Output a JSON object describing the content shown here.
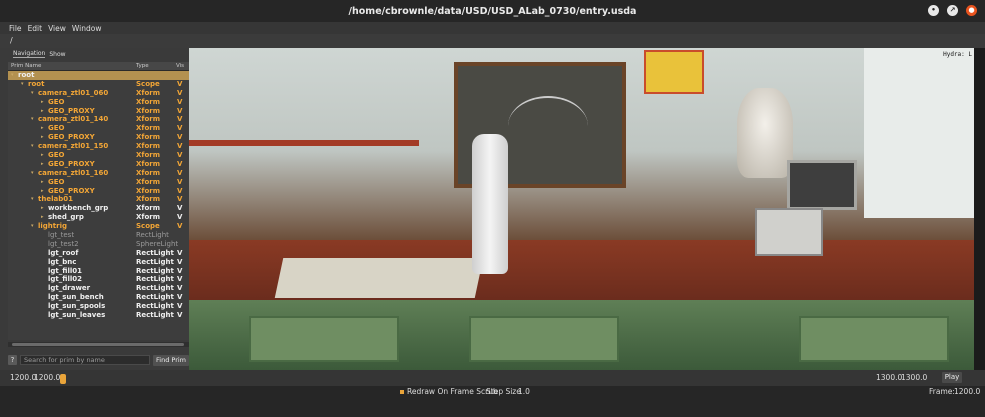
{
  "window": {
    "title": "/home/cbrownle/data/USD/USD_ALab_0730/entry.usda",
    "controls": {
      "minimize": "•",
      "maximize": "↗",
      "close": "●"
    }
  },
  "menu": [
    "File",
    "Edit",
    "View",
    "Window"
  ],
  "path": "/",
  "left_panel": {
    "tabs": [
      "Navigation",
      "Show"
    ],
    "columns": {
      "name": "Prim Name",
      "type": "Type",
      "vis": "Vis"
    },
    "rows": [
      {
        "name": "root",
        "type": "",
        "vis": "",
        "depth": 0,
        "arrow": "▾",
        "color": "white",
        "selected": true
      },
      {
        "name": "root",
        "type": "Scope",
        "vis": "V",
        "depth": 1,
        "arrow": "▾",
        "color": "orange"
      },
      {
        "name": "camera_ztl01_060",
        "type": "Xform",
        "vis": "V",
        "depth": 2,
        "arrow": "▾",
        "color": "orange"
      },
      {
        "name": "GEO",
        "type": "Xform",
        "vis": "V",
        "depth": 3,
        "arrow": "▸",
        "color": "orange"
      },
      {
        "name": "GEO_PROXY",
        "type": "Xform",
        "vis": "V",
        "depth": 3,
        "arrow": "▸",
        "color": "orange"
      },
      {
        "name": "camera_ztl01_140",
        "type": "Xform",
        "vis": "V",
        "depth": 2,
        "arrow": "▾",
        "color": "orange"
      },
      {
        "name": "GEO",
        "type": "Xform",
        "vis": "V",
        "depth": 3,
        "arrow": "▸",
        "color": "orange"
      },
      {
        "name": "GEO_PROXY",
        "type": "Xform",
        "vis": "V",
        "depth": 3,
        "arrow": "▸",
        "color": "orange"
      },
      {
        "name": "camera_ztl01_150",
        "type": "Xform",
        "vis": "V",
        "depth": 2,
        "arrow": "▾",
        "color": "orange"
      },
      {
        "name": "GEO",
        "type": "Xform",
        "vis": "V",
        "depth": 3,
        "arrow": "▸",
        "color": "orange"
      },
      {
        "name": "GEO_PROXY",
        "type": "Xform",
        "vis": "V",
        "depth": 3,
        "arrow": "▸",
        "color": "orange"
      },
      {
        "name": "camera_ztl01_160",
        "type": "Xform",
        "vis": "V",
        "depth": 2,
        "arrow": "▾",
        "color": "orange"
      },
      {
        "name": "GEO",
        "type": "Xform",
        "vis": "V",
        "depth": 3,
        "arrow": "▸",
        "color": "orange"
      },
      {
        "name": "GEO_PROXY",
        "type": "Xform",
        "vis": "V",
        "depth": 3,
        "arrow": "▸",
        "color": "orange"
      },
      {
        "name": "thelab01",
        "type": "Xform",
        "vis": "V",
        "depth": 2,
        "arrow": "▾",
        "color": "orange"
      },
      {
        "name": "workbench_grp",
        "type": "Xform",
        "vis": "V",
        "depth": 3,
        "arrow": "▸",
        "color": "white"
      },
      {
        "name": "shed_grp",
        "type": "Xform",
        "vis": "V",
        "depth": 3,
        "arrow": "▸",
        "color": "white"
      },
      {
        "name": "lightrig",
        "type": "Scope",
        "vis": "V",
        "depth": 2,
        "arrow": "▾",
        "color": "orange"
      },
      {
        "name": "lgt_test",
        "type": "RectLight",
        "vis": "",
        "depth": 3,
        "arrow": "",
        "color": "gray"
      },
      {
        "name": "lgt_test2",
        "type": "SphereLight",
        "vis": "",
        "depth": 3,
        "arrow": "",
        "color": "gray"
      },
      {
        "name": "lgt_roof",
        "type": "RectLight",
        "vis": "V",
        "depth": 3,
        "arrow": "",
        "color": "white"
      },
      {
        "name": "lgt_bnc",
        "type": "RectLight",
        "vis": "V",
        "depth": 3,
        "arrow": "",
        "color": "white"
      },
      {
        "name": "lgt_fill01",
        "type": "RectLight",
        "vis": "V",
        "depth": 3,
        "arrow": "",
        "color": "white"
      },
      {
        "name": "lgt_fill02",
        "type": "RectLight",
        "vis": "V",
        "depth": 3,
        "arrow": "",
        "color": "white"
      },
      {
        "name": "lgt_drawer",
        "type": "RectLight",
        "vis": "V",
        "depth": 3,
        "arrow": "",
        "color": "white"
      },
      {
        "name": "lgt_sun_bench",
        "type": "RectLight",
        "vis": "V",
        "depth": 3,
        "arrow": "",
        "color": "white"
      },
      {
        "name": "lgt_sun_spools",
        "type": "RectLight",
        "vis": "V",
        "depth": 3,
        "arrow": "",
        "color": "white"
      },
      {
        "name": "lgt_sun_leaves",
        "type": "RectLight",
        "vis": "V",
        "depth": 3,
        "arrow": "",
        "color": "white"
      }
    ],
    "search": {
      "help": "?",
      "placeholder": "Search for prim by name",
      "button": "Find Prim"
    }
  },
  "viewport": {
    "hud_text": "Hydra: L"
  },
  "timeline": {
    "start": "1200.0",
    "current": "1200.0",
    "end_a": "1300.0",
    "end_b": "1300.0",
    "play": "Play"
  },
  "bottom": {
    "redraw_label": "Redraw On Frame Scrub",
    "step_label": "Step Size",
    "step_value": "1.0",
    "frame_label": "Frame:",
    "frame_value": "1200.0"
  },
  "colors": {
    "accent": "#e9a43a",
    "selected_row": "#b39150",
    "orange_text": "#f3a636"
  }
}
